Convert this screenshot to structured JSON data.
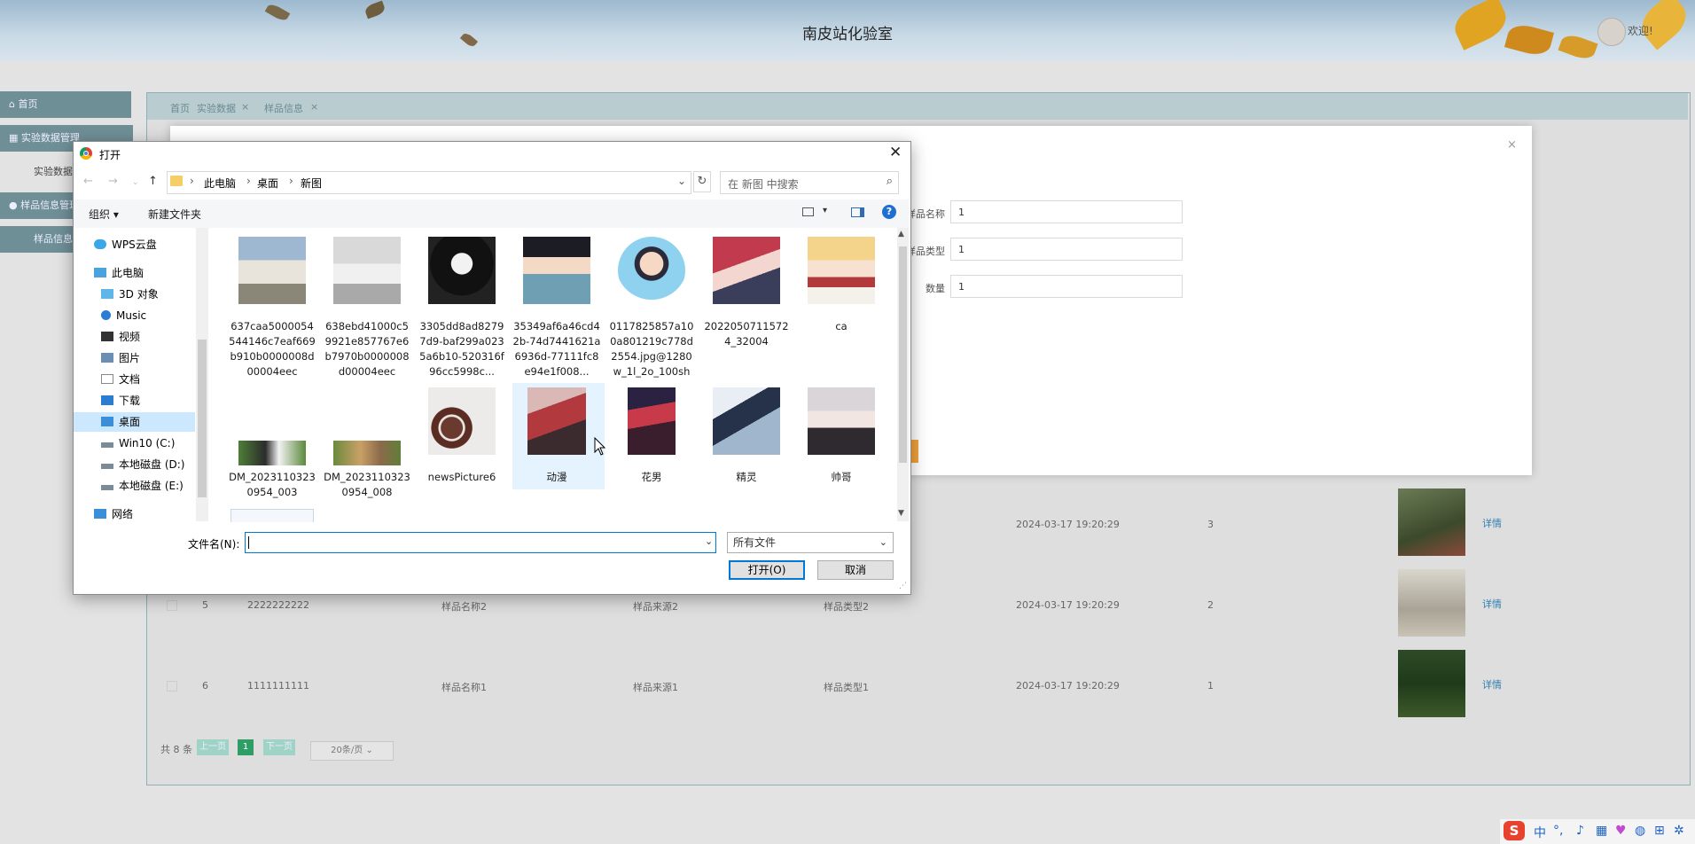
{
  "app": {
    "title": "南皮站化验室",
    "welcome": "欢迎!"
  },
  "sidebar": {
    "items": [
      {
        "label": "首页"
      },
      {
        "label": "实验数据管理"
      },
      {
        "label": "实验数据"
      },
      {
        "label": "样品信息管理"
      },
      {
        "label": "样品信息"
      }
    ]
  },
  "tabs": [
    {
      "label": "首页"
    },
    {
      "label": "实验数据"
    },
    {
      "label": "样品信息"
    }
  ],
  "table": {
    "rows": [
      {
        "id": "",
        "code": "",
        "name": "",
        "source": "",
        "type": "",
        "time": "2024-03-17 19:20:29",
        "qty": "3",
        "action": "详情"
      },
      {
        "id": "5",
        "code": "2222222222",
        "name": "样品名称2",
        "source": "样品来源2",
        "type": "样品类型2",
        "time": "2024-03-17 19:20:29",
        "qty": "2",
        "action": "详情"
      },
      {
        "id": "6",
        "code": "1111111111",
        "name": "样品名称1",
        "source": "样品来源1",
        "type": "样品类型1",
        "time": "2024-03-17 19:20:29",
        "qty": "1",
        "action": "详情"
      }
    ]
  },
  "pager": {
    "total": "共 8 条",
    "prev": "上一页",
    "current": "1",
    "next": "下一页",
    "page_size": "20条/页"
  },
  "modal": {
    "fields": [
      {
        "label": "样品名称",
        "value": "1"
      },
      {
        "label": "样品类型",
        "value": "1"
      },
      {
        "label": "数量",
        "value": "1"
      }
    ],
    "close": "×"
  },
  "dialog": {
    "title": "打开",
    "close": "✕",
    "breadcrumb": [
      "此电脑",
      "桌面",
      "新图"
    ],
    "search_placeholder": "在 新图 中搜索",
    "organize": "组织 ▾",
    "new_folder": "新建文件夹",
    "nav": [
      {
        "label": "WPS云盘",
        "icon": "cloud-icon"
      },
      {
        "label": "此电脑",
        "icon": "computer-icon"
      },
      {
        "label": "3D 对象",
        "icon": "cube-icon"
      },
      {
        "label": "Music",
        "icon": "music-icon"
      },
      {
        "label": "视频",
        "icon": "video-icon"
      },
      {
        "label": "图片",
        "icon": "pictures-icon"
      },
      {
        "label": "文档",
        "icon": "document-icon"
      },
      {
        "label": "下载",
        "icon": "download-icon"
      },
      {
        "label": "桌面",
        "icon": "desktop-icon"
      },
      {
        "label": "Win10 (C:)",
        "icon": "drive-icon"
      },
      {
        "label": "本地磁盘 (D:)",
        "icon": "drive-icon"
      },
      {
        "label": "本地磁盘 (E:)",
        "icon": "drive-icon"
      },
      {
        "label": "网络",
        "icon": "network-icon"
      }
    ],
    "files": [
      {
        "name": "637caa5000054544146c7eaf669b910b0000008d00004eec"
      },
      {
        "name": "638ebd41000c59921e857767e6b7970b0000008d00004eec"
      },
      {
        "name": "3305dd8ad82797d9-baf299a0235a6b10-520316f96cc5998c..."
      },
      {
        "name": "35349af6a46cd42b-74d7441621a6936d-77111fc8e94e1f008..."
      },
      {
        "name": "0117825857a100a801219c778d2554.jpg@1280w_1l_2o_100sh"
      },
      {
        "name": "20220507115724_32004"
      },
      {
        "name": "ca"
      },
      {
        "name": "DM_20231103230954_003"
      },
      {
        "name": "DM_20231103230954_008"
      },
      {
        "name": "newsPicture6"
      },
      {
        "name": "动漫"
      },
      {
        "name": "花男"
      },
      {
        "name": "精灵"
      },
      {
        "name": "帅哥"
      }
    ],
    "filename_label": "文件名(N):",
    "filename_value": "",
    "filter": "所有文件",
    "open_button": "打开(O)",
    "cancel_button": "取消"
  },
  "tray": {
    "ime_logo": "S",
    "ime_mode": "中"
  },
  "colors": {
    "accent": "#0078d7",
    "selection": "#cce8ff",
    "sidebar": "#6f8f97",
    "orange": "#f3a33c"
  }
}
